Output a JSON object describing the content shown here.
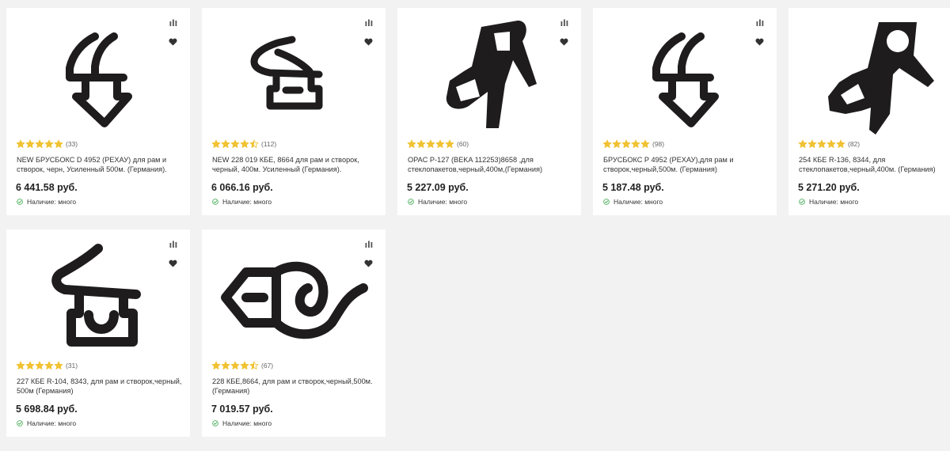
{
  "colors": {
    "background": "#f2f2f2",
    "card": "#ffffff",
    "star": "#f0c232",
    "stock_check": "#3aa64a",
    "shape": "#1e1c1c"
  },
  "products": [
    {
      "image_icon": "seal-profile-arrow-icon",
      "rating_stars": 5,
      "reviews": "(33)",
      "title": "NEW БРУСБОКС D 4952 (РЕХАУ) для рам и створок, черн, Усиленный 500м. (Германия).",
      "price": "6 441.58 руб.",
      "stock": "Наличие: много"
    },
    {
      "image_icon": "seal-profile-loop-icon",
      "rating_stars": 4.5,
      "reviews": "(112)",
      "title": "NEW 228 019 КБЕ, 8664 для рам и створок, черный, 400м. Усиленный (Германия).",
      "price": "6 066.16 руб.",
      "stock": "Наличие: много"
    },
    {
      "image_icon": "seal-profile-hook-icon",
      "rating_stars": 5,
      "reviews": "(60)",
      "title": "OPAC P-127 (BEKA 112253)8658 ,для стеклопакетов,черный,400м,(Германия)",
      "price": "5 227.09 руб.",
      "stock": "Наличие: много"
    },
    {
      "image_icon": "seal-profile-arrow-icon",
      "rating_stars": 5,
      "reviews": "(98)",
      "title": "БРУСБОКС P 4952 (РЕХАУ),для рам и створок,черный,500м. (Германия)",
      "price": "5 187.48 руб.",
      "stock": "Наличие: много"
    },
    {
      "image_icon": "seal-profile-ring-icon",
      "rating_stars": 5,
      "reviews": "(82)",
      "title": "254 КБЕ R-136, 8344, для стеклопакетов,черный,400м. (Германия)",
      "price": "5 271.20 руб.",
      "stock": "Наличие: много"
    },
    {
      "image_icon": "seal-profile-bulb-icon",
      "rating_stars": 5,
      "reviews": "(31)",
      "title": "227 КБЕ R-104, 8343, для рам и створок,черный, 500м (Германия)",
      "price": "5 698.84 руб.",
      "stock": "Наличие: много"
    },
    {
      "image_icon": "seal-profile-wave-icon",
      "rating_stars": 4.5,
      "reviews": "(67)",
      "title": "228 КБЕ,8664, для рам и створок,черный,500м. (Германия)",
      "price": "7 019.57 руб.",
      "stock": "Наличие: много"
    }
  ]
}
